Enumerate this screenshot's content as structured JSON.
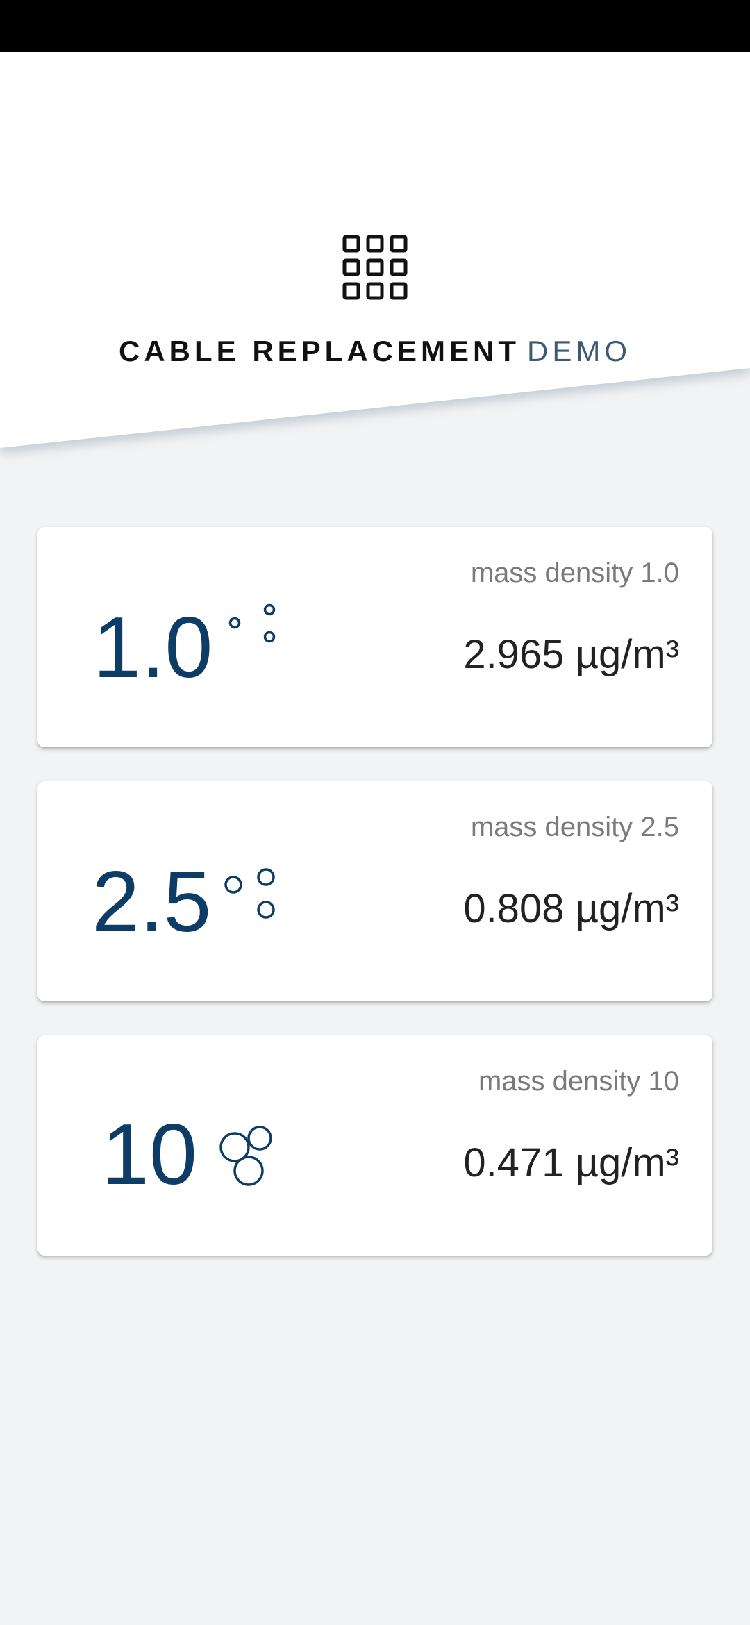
{
  "header": {
    "title_main": "CABLE REPLACEMENT",
    "title_accent": "DEMO",
    "icon": "grid-icon"
  },
  "cards": [
    {
      "pm": "1.0",
      "label": "mass density 1.0",
      "reading": "2.965 µg/m³",
      "icon": "particles-small-icon"
    },
    {
      "pm": "2.5",
      "label": "mass density 2.5",
      "reading": "0.808 µg/m³",
      "icon": "particles-medium-icon"
    },
    {
      "pm": "10",
      "label": "mass density 10",
      "reading": "0.471 µg/m³",
      "icon": "particles-large-icon"
    }
  ],
  "colors": {
    "accent": "#0d3d66",
    "background": "#f2f3f5",
    "card": "#ffffff",
    "label": "#7a7a7a"
  }
}
